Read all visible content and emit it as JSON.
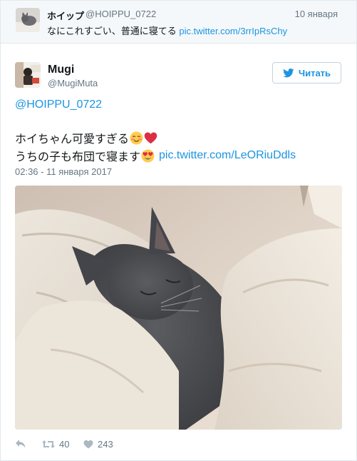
{
  "parent_tweet": {
    "name": "ホイップ",
    "handle": "@HOIPPU_0722",
    "date": "10 января",
    "text": "なにこれすごい、普通に寝てる",
    "link": "pic.twitter.com/3rrIpRsChy"
  },
  "tweet": {
    "name": "Mugi",
    "handle": "@MugiMuta",
    "follow_label": "Читать",
    "reply_to": "@HOIPPU_0722",
    "line1": "ホイちゃん可愛すぎる",
    "line2": "うちの子も布団で寝ます",
    "link": "pic.twitter.com/LeORiuDdls",
    "timestamp": "02:36 - 11 января 2017"
  },
  "emojis": [
    "smiling-blushing-emoji",
    "red-heart-emoji",
    "heart-eyes-emoji"
  ],
  "actions": {
    "retweets": "40",
    "likes": "243"
  },
  "colors": {
    "link": "#1b95e0",
    "muted": "#657786",
    "heart": "#dd2e44"
  }
}
